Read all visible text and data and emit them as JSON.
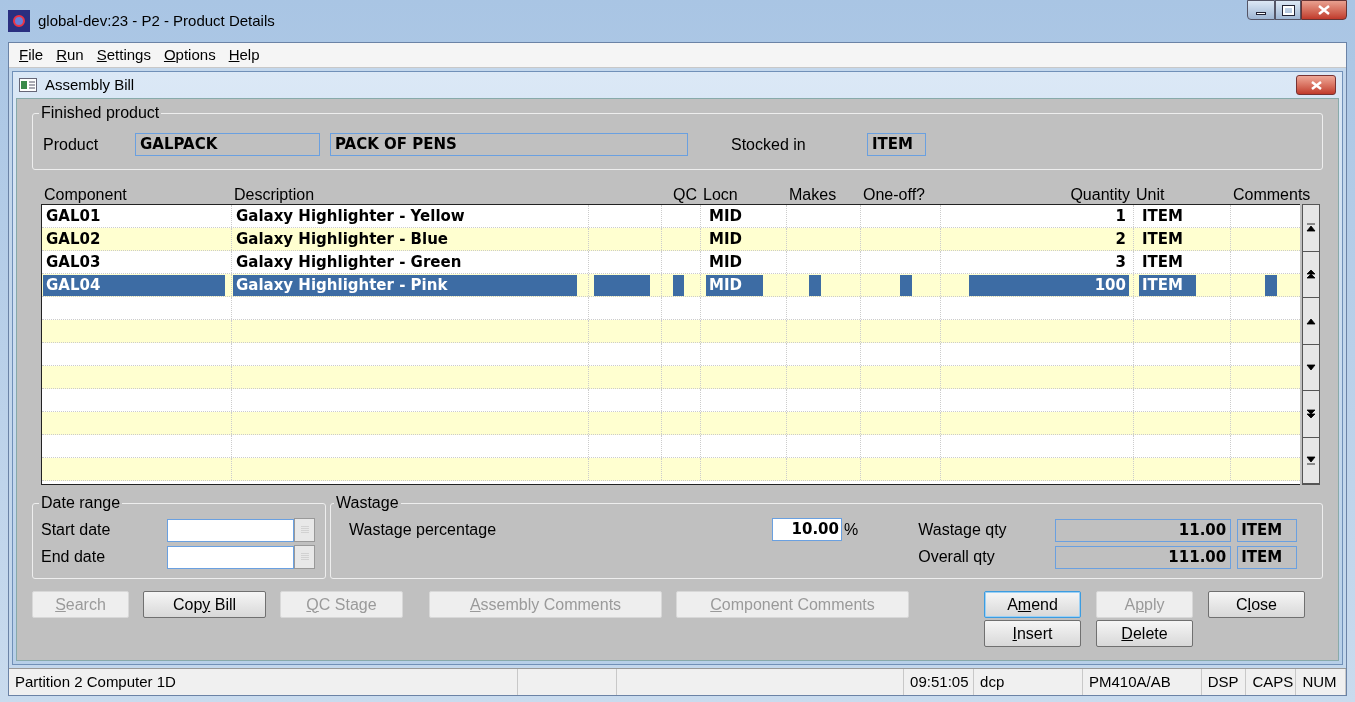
{
  "window": {
    "title": "global-dev:23 - P2 - Product Details"
  },
  "menu": [
    {
      "key": "F",
      "after": "ile"
    },
    {
      "key": "R",
      "after": "un"
    },
    {
      "key": "S",
      "after": "ettings"
    },
    {
      "key": "O",
      "after": "ptions"
    },
    {
      "key": "H",
      "after": "elp"
    }
  ],
  "child_window": {
    "title": "Assembly Bill"
  },
  "finished_product": {
    "title": "Finished product",
    "product_label": "Product",
    "product_code": "GALPACK",
    "product_name": "PACK OF PENS",
    "stocked_label": "Stocked in",
    "stocked_unit": "ITEM"
  },
  "table": {
    "columns": [
      "Component",
      "Description",
      "QC",
      "Locn",
      "Makes",
      "One-off?",
      "Quantity",
      "Unit",
      "Comments"
    ],
    "rows": [
      {
        "component": "GAL01",
        "description": "Galaxy Highlighter - Yellow",
        "locn": "MID",
        "quantity": "1",
        "unit": "ITEM",
        "selected": false
      },
      {
        "component": "GAL02",
        "description": "Galaxy Highlighter - Blue",
        "locn": "MID",
        "quantity": "2",
        "unit": "ITEM",
        "selected": false
      },
      {
        "component": "GAL03",
        "description": "Galaxy Highlighter - Green",
        "locn": "MID",
        "quantity": "3",
        "unit": "ITEM",
        "selected": false
      },
      {
        "component": "GAL04",
        "description": "Galaxy Highlighter - Pink",
        "locn": "MID",
        "quantity": "100",
        "unit": "ITEM",
        "selected": true
      }
    ]
  },
  "date_range": {
    "title": "Date range",
    "start_label": "Start date",
    "end_label": "End date"
  },
  "wastage": {
    "title": "Wastage",
    "percentage_label": "Wastage percentage",
    "percentage": "10.00",
    "percent_sign": "%",
    "wastage_qty_label": "Wastage qty",
    "wastage_qty": "11.00",
    "wastage_unit": "ITEM",
    "overall_qty_label": "Overall qty",
    "overall_qty": "111.00",
    "overall_unit": "ITEM"
  },
  "buttons": [
    {
      "key": "S",
      "after": "earch",
      "disabled": true,
      "focused": false
    },
    {
      "before": "Cop",
      "key": "y",
      "after": " Bill",
      "disabled": false,
      "focused": false
    },
    {
      "key": "Q",
      "after": "C Stage",
      "disabled": true,
      "focused": false
    },
    {
      "key": "A",
      "after": "ssembly Comments",
      "disabled": true,
      "focused": false
    },
    {
      "key": "C",
      "after": "omponent Comments",
      "disabled": true,
      "focused": false
    },
    {
      "before": "A",
      "key": "m",
      "after": "end",
      "disabled": false,
      "focused": true
    },
    {
      "before": "A",
      "key": "p",
      "after": "ply",
      "disabled": true,
      "focused": false
    },
    {
      "before": "C",
      "key": "l",
      "after": "ose",
      "disabled": false,
      "focused": false
    },
    {
      "key": "I",
      "after": "nsert",
      "disabled": false,
      "focused": false
    },
    {
      "key": "D",
      "after": "elete",
      "disabled": false,
      "focused": false
    }
  ],
  "status_bar": [
    "Partition 2 Computer 1D",
    "09:51:05",
    "dcp",
    "PM410A/AB",
    "DSP",
    "CAPS",
    "NUM"
  ]
}
